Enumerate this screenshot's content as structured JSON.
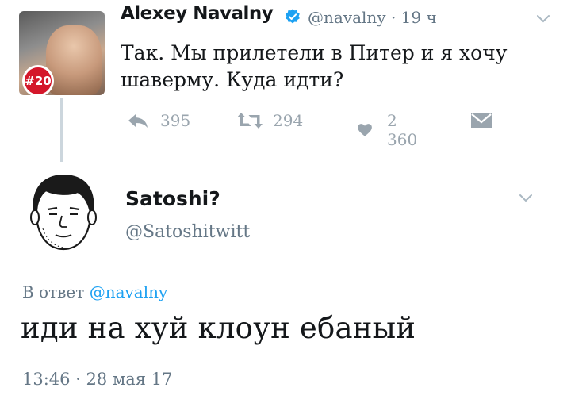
{
  "tweet": {
    "author_name": "Alexey Navalny",
    "author_handle": "@navalny",
    "time_ago": "· 19 ч",
    "text": "Так. Мы прилетели в Питер и я хочу шаверму. Куда идти?",
    "avatar_badge": "#20",
    "replies": "395",
    "retweets": "294",
    "likes": "2 360"
  },
  "reply": {
    "author_name": "Satoshi?",
    "author_handle": "@Satoshitwitt",
    "reply_prefix": "В ответ",
    "reply_mention": "@navalny",
    "text": "иди на хуй клоун ебаный",
    "timestamp": "13:46 · 28 мая 17"
  },
  "colors": {
    "accent": "#1da1f2",
    "muted": "#657786",
    "icon": "#9aa5ae",
    "badge": "#d4172a"
  },
  "icons": [
    "verified-icon",
    "chevron-down-icon",
    "reply-icon",
    "retweet-icon",
    "heart-icon",
    "message-icon"
  ]
}
